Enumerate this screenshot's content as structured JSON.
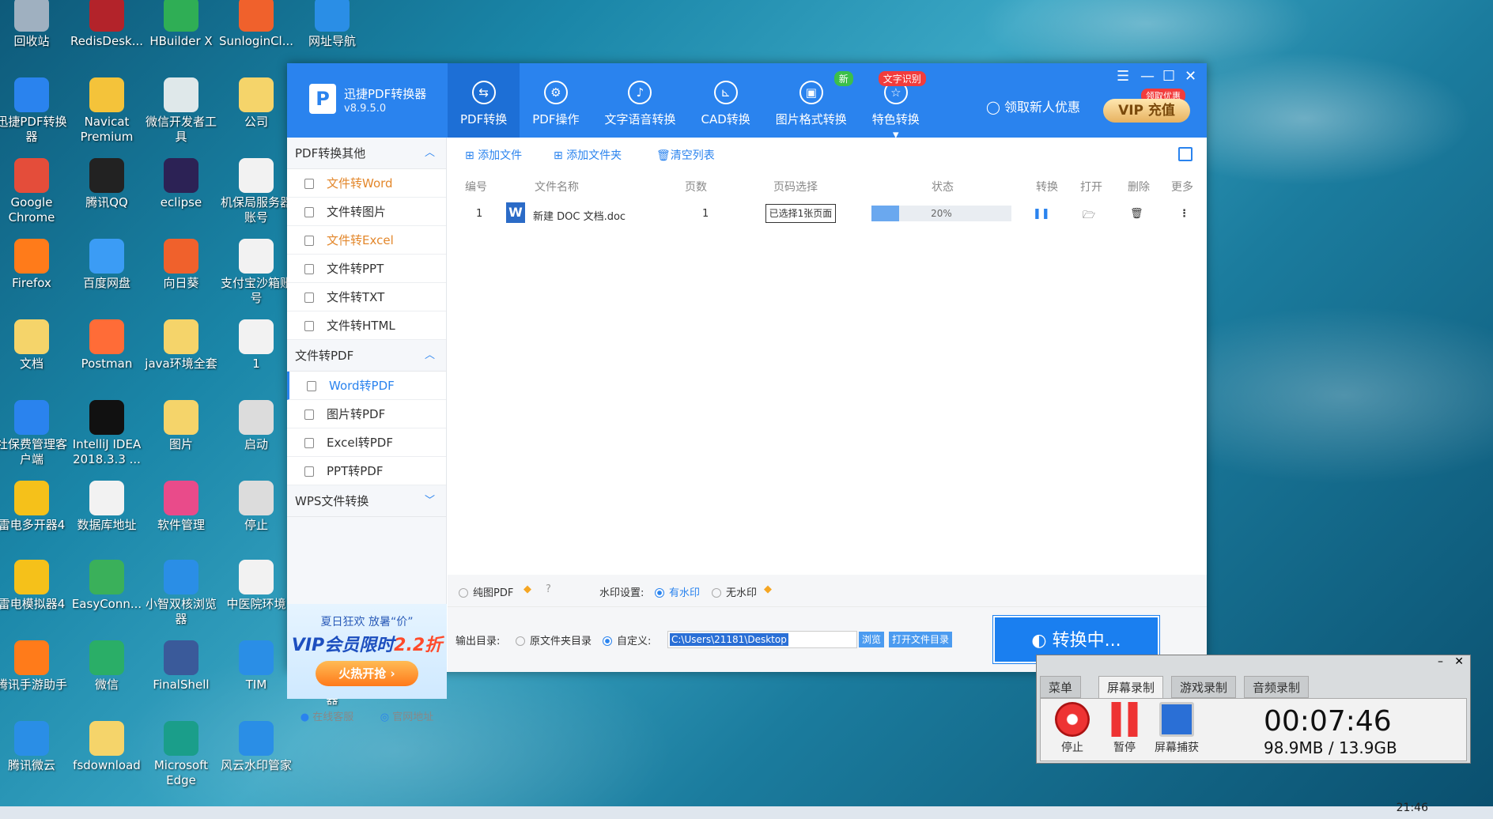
{
  "desktop": {
    "icons": [
      {
        "label": "回收站",
        "color": "#9fb0c0"
      },
      {
        "label": "RedisDesk...",
        "color": "#b3232a"
      },
      {
        "label": "HBuilder X",
        "color": "#2fae55"
      },
      {
        "label": "SunloginCl...",
        "color": "#f0612c"
      },
      {
        "label": "网址导航",
        "color": "#2a8ee6"
      },
      {
        "label": "迅捷PDF转换器",
        "color": "#2a83ee"
      },
      {
        "label": "Navicat Premium",
        "color": "#f4c33a"
      },
      {
        "label": "微信开发者工具",
        "color": "#dfe8ea"
      },
      {
        "label": "公司",
        "color": "#f5d46a"
      },
      {
        "label": "Google Chrome",
        "color": "#e44d3a"
      },
      {
        "label": "腾讯QQ",
        "color": "#222222"
      },
      {
        "label": "eclipse",
        "color": "#2c2255"
      },
      {
        "label": "机保局服务器账号",
        "color": "#f2f2f2"
      },
      {
        "label": "Firefox",
        "color": "#ff7b1a"
      },
      {
        "label": "百度网盘",
        "color": "#3b9cf5"
      },
      {
        "label": "向日葵",
        "color": "#f0612c"
      },
      {
        "label": "支付宝沙箱账号",
        "color": "#f2f2f2"
      },
      {
        "label": "文档",
        "color": "#f5d46a"
      },
      {
        "label": "Postman",
        "color": "#ff6c37"
      },
      {
        "label": "java环境全套",
        "color": "#f5d46a"
      },
      {
        "label": "1",
        "color": "#f2f2f2"
      },
      {
        "label": "社保费管理客户端",
        "color": "#2a83ee"
      },
      {
        "label": "IntelliJ IDEA 2018.3.3 ...",
        "color": "#111111"
      },
      {
        "label": "图片",
        "color": "#f5d46a"
      },
      {
        "label": "启动",
        "color": "#dcdcdc"
      },
      {
        "label": "雷电多开器4",
        "color": "#f5c11a"
      },
      {
        "label": "数据库地址",
        "color": "#f2f2f2"
      },
      {
        "label": "软件管理",
        "color": "#e94b8a"
      },
      {
        "label": "停止",
        "color": "#dcdcdc"
      },
      {
        "label": "雷电模拟器4",
        "color": "#f5c11a"
      },
      {
        "label": "EasyConn...",
        "color": "#3ab05a"
      },
      {
        "label": "小智双核浏览器",
        "color": "#2a8ee6"
      },
      {
        "label": "中医院环境",
        "color": "#f2f2f2"
      },
      {
        "label": "腾讯手游助手",
        "color": "#ff7b1a"
      },
      {
        "label": "微信",
        "color": "#2aae67"
      },
      {
        "label": "FinalShell",
        "color": "#3a5a9a"
      },
      {
        "label": "TIM",
        "color": "#2a8ee6"
      },
      {
        "label": "烁光视频转换器",
        "color": "#f2f2f2"
      },
      {
        "label": "腾讯微云",
        "color": "#2a8ee6"
      },
      {
        "label": "fsdownload",
        "color": "#f5d46a"
      },
      {
        "label": "Microsoft Edge",
        "color": "#1a9e8a"
      },
      {
        "label": "风云水印管家",
        "color": "#2a8ee6"
      }
    ]
  },
  "app": {
    "name": "迅捷PDF转换器",
    "version": "v8.9.5.0",
    "accent": "#2a83ee",
    "nav": [
      {
        "label": "PDF转换",
        "icon": "pdf-convert-icon",
        "glyph": "⇆",
        "active": true,
        "badge": ""
      },
      {
        "label": "PDF操作",
        "icon": "pdf-settings-icon",
        "glyph": "⚙",
        "active": false,
        "badge": ""
      },
      {
        "label": "文字语音转换",
        "icon": "audio-wave-icon",
        "glyph": "♪",
        "active": false,
        "badge": ""
      },
      {
        "label": "CAD转换",
        "icon": "cad-icon",
        "glyph": "⊾",
        "active": false,
        "badge": ""
      },
      {
        "label": "图片格式转换",
        "icon": "image-icon",
        "glyph": "▣",
        "active": false,
        "badge": "新"
      },
      {
        "label": "特色转换",
        "icon": "star-icon",
        "glyph": "☆",
        "active": false,
        "badge": "文字识别"
      }
    ],
    "promo": "领取新人优惠",
    "vip_label": "VIP 充值",
    "vip_badge": "领取优惠"
  },
  "sidebar": {
    "sections": [
      {
        "title": "PDF转换其他",
        "chevron": "︿",
        "items": [
          {
            "label": "文件转Word",
            "state": "orange"
          },
          {
            "label": "文件转图片",
            "state": ""
          },
          {
            "label": "文件转Excel",
            "state": "orange"
          },
          {
            "label": "文件转PPT",
            "state": ""
          },
          {
            "label": "文件转TXT",
            "state": ""
          },
          {
            "label": "文件转HTML",
            "state": ""
          }
        ]
      },
      {
        "title": "文件转PDF",
        "chevron": "︿",
        "items": [
          {
            "label": "Word转PDF",
            "state": "sel"
          },
          {
            "label": "图片转PDF",
            "state": ""
          },
          {
            "label": "Excel转PDF",
            "state": ""
          },
          {
            "label": "PPT转PDF",
            "state": ""
          }
        ]
      },
      {
        "title": "WPS文件转换",
        "chevron": "﹀",
        "items": []
      }
    ],
    "ad": {
      "line1": "夏日狂欢 放暑“价”",
      "line2a": "VIP会员限时",
      "line2b": "2.2折",
      "button": "火热开抢 ›"
    },
    "links": {
      "service": "在线客服",
      "website": "官网地址"
    }
  },
  "toolbar": {
    "add_file": "添加文件",
    "add_folder": "添加文件夹",
    "clear_list": "清空列表"
  },
  "table": {
    "headers": [
      "编号",
      "文件名称",
      "页数",
      "页码选择",
      "状态",
      "转换",
      "打开",
      "删除",
      "更多"
    ],
    "rows": [
      {
        "index": "1",
        "filename": "新建 DOC 文档.doc",
        "pages": "1",
        "page_selection": "已选择1张页面",
        "progress": 0.2,
        "status": "20%"
      }
    ]
  },
  "options": {
    "pure_image_pdf": "纯图PDF",
    "watermark_label": "水印设置:",
    "with_watermark": "有水印",
    "without_watermark": "无水印",
    "output_label": "输出目录:",
    "original_dir": "原文件夹目录",
    "custom": "自定义:",
    "path": "C:\\Users\\21181\\Desktop",
    "browse": "浏览",
    "open_dir": "打开文件目录",
    "convert": "转换中..."
  },
  "recorder": {
    "tabs": [
      "菜单",
      "屏幕录制",
      "游戏录制",
      "音频录制"
    ],
    "buttons": {
      "stop": "停止",
      "pause": "暂停",
      "capture": "屏幕捕获"
    },
    "time": "00:07:46",
    "size": "98.9MB / 13.9GB"
  },
  "taskbar": {
    "clock": "21:46"
  }
}
